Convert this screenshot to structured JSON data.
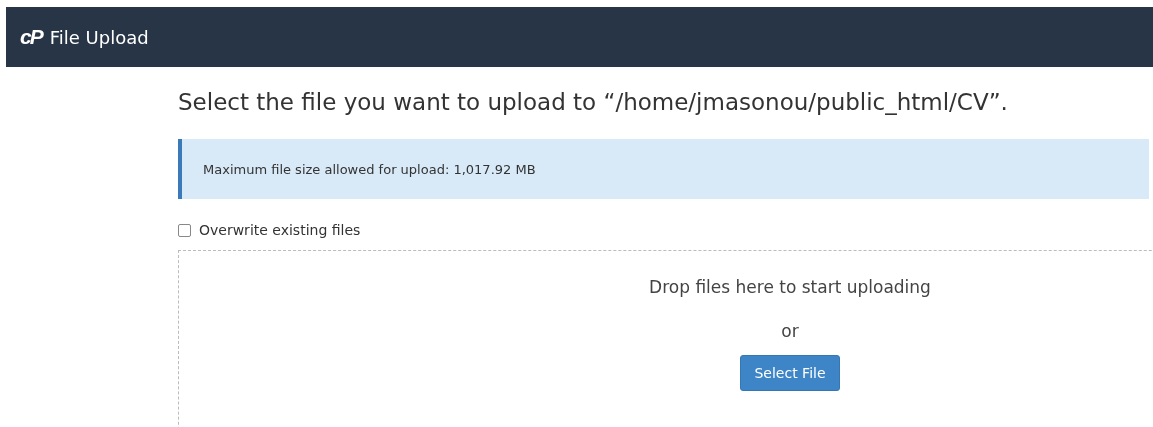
{
  "header": {
    "logo": "cP",
    "title": "File Upload"
  },
  "heading": "Select the file you want to upload to “/home/jmasonou/public_html/CV”.",
  "info": "Maximum file size allowed for upload: 1,017.92 MB",
  "overwrite": {
    "label": "Overwrite existing files",
    "checked": false
  },
  "dropzone": {
    "prompt": "Drop files here to start uploading",
    "or": "or",
    "button": "Select File"
  }
}
